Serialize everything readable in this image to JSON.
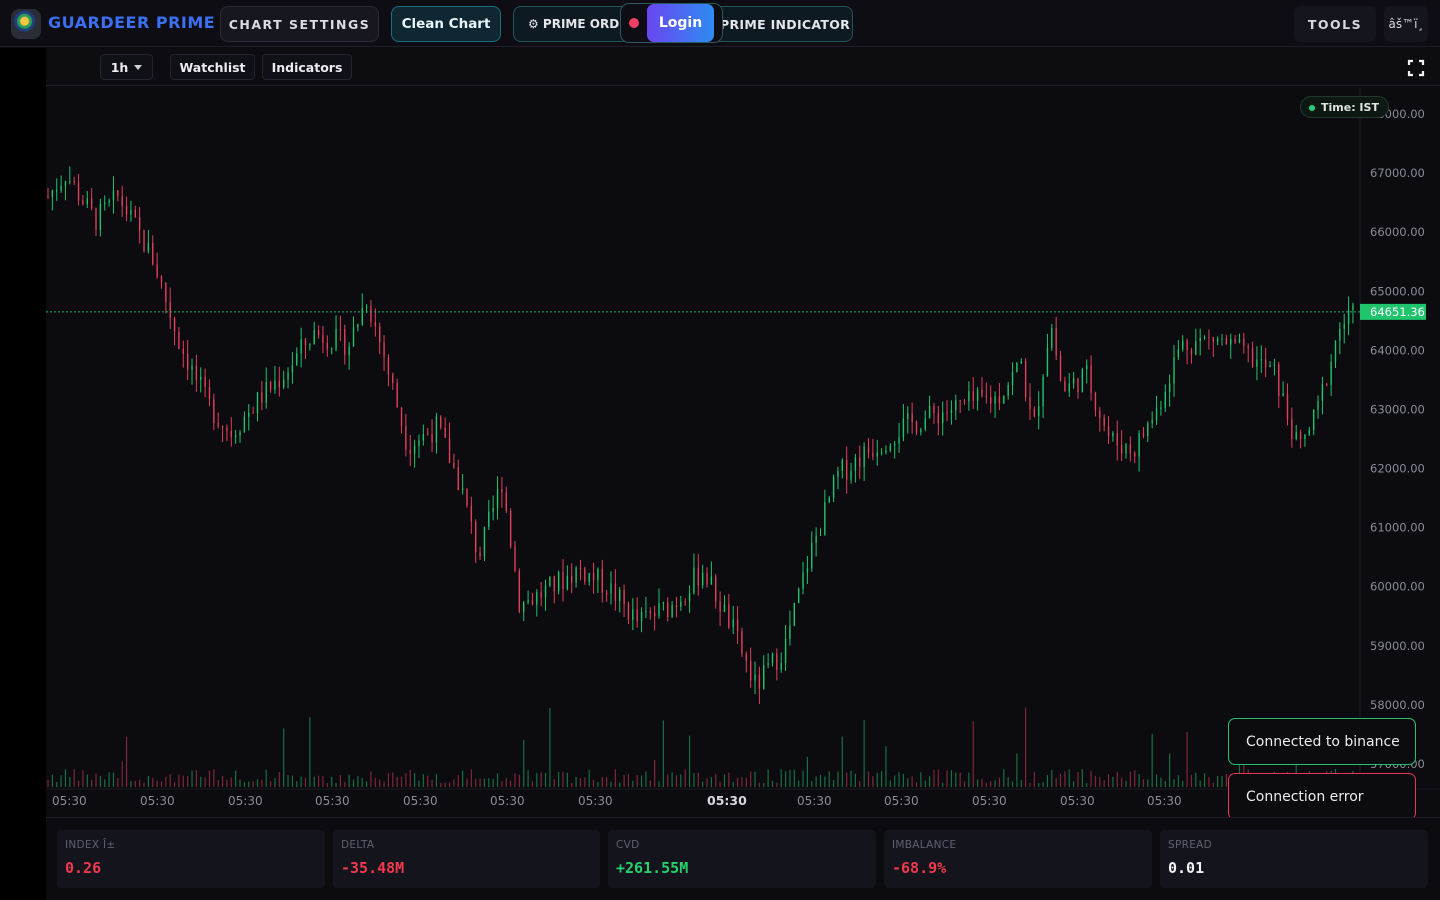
{
  "header": {
    "brand": "GUARDEER PRIME",
    "chart_settings_label": "CHART SETTINGS",
    "clean_chart_label": "Clean Chart",
    "prime_order_label": "⚙ PRIME ORDER",
    "prime_indicator_label": "PRIME INDICATOR",
    "login_label": "Login",
    "tools_label": "TOOLS",
    "misc_label": "âš™ï¸"
  },
  "toolbar": {
    "interval": "1h",
    "watchlist_label": "Watchlist",
    "indicators_label": "Indicators"
  },
  "chart": {
    "timezone_label": "Time: IST",
    "up_color": "#22c36b",
    "down_color": "#e0405a",
    "last_price_color": "#1fc46d"
  },
  "chart_data": {
    "type": "candlestick",
    "interval": "1h",
    "last_price": 64651.36,
    "last_price_label": "64651.36",
    "ylim": [
      57000,
      68000
    ],
    "y_ticks": [
      "57000.00",
      "58000.00",
      "59000.00",
      "60000.00",
      "61000.00",
      "62000.00",
      "63000.00",
      "64000.00",
      "65000.00",
      "66000.00",
      "67000.00",
      "68000.00"
    ],
    "x_tick_labels": [
      "05:30",
      "05:30",
      "05:30",
      "05:30",
      "05:30",
      "05:30",
      "05:30",
      "05:30",
      "05:30",
      "05:30",
      "05:30",
      "05:30",
      "05:30"
    ],
    "x_tick_bold_index": 7,
    "close_path": [
      [
        0,
        66600
      ],
      [
        3,
        67000
      ],
      [
        8,
        66200
      ],
      [
        12,
        66600
      ],
      [
        18,
        65500
      ],
      [
        22,
        64200
      ],
      [
        27,
        63100
      ],
      [
        31,
        62600
      ],
      [
        36,
        63200
      ],
      [
        40,
        63600
      ],
      [
        45,
        64300
      ],
      [
        51,
        64100
      ],
      [
        54,
        64900
      ],
      [
        57,
        63900
      ],
      [
        61,
        62400
      ],
      [
        66,
        62700
      ],
      [
        70,
        61700
      ],
      [
        73,
        60500
      ],
      [
        77,
        61800
      ],
      [
        80,
        59700
      ],
      [
        84,
        59900
      ],
      [
        90,
        60300
      ],
      [
        95,
        60000
      ],
      [
        100,
        59400
      ],
      [
        106,
        59700
      ],
      [
        111,
        60300
      ],
      [
        116,
        59300
      ],
      [
        120,
        58300
      ],
      [
        125,
        59000
      ],
      [
        129,
        60500
      ],
      [
        134,
        61900
      ],
      [
        139,
        62300
      ],
      [
        145,
        62700
      ],
      [
        150,
        62900
      ],
      [
        156,
        63100
      ],
      [
        161,
        63200
      ],
      [
        165,
        63800
      ],
      [
        167,
        62600
      ],
      [
        170,
        64500
      ],
      [
        172,
        63300
      ],
      [
        176,
        63600
      ],
      [
        180,
        62500
      ],
      [
        184,
        62300
      ],
      [
        188,
        63000
      ],
      [
        192,
        64100
      ],
      [
        198,
        64200
      ],
      [
        202,
        64000
      ],
      [
        208,
        63600
      ],
      [
        212,
        62300
      ],
      [
        215,
        62900
      ],
      [
        219,
        64400
      ],
      [
        222,
        64651
      ]
    ],
    "volume_shape": "low baseline bars with occasional spikes"
  },
  "toasts": {
    "ok": "Connected to binance",
    "error": "Connection error"
  },
  "stats": {
    "index": {
      "label": "INDEX Î±",
      "value": "0.26"
    },
    "delta": {
      "label": "DELTA",
      "value": "-35.48M"
    },
    "cvd": {
      "label": "CVD",
      "value": "+261.55M"
    },
    "imbalance": {
      "label": "IMBALANCE",
      "value": "-68.9%"
    },
    "spread": {
      "label": "SPREAD",
      "value": "0.01"
    }
  }
}
